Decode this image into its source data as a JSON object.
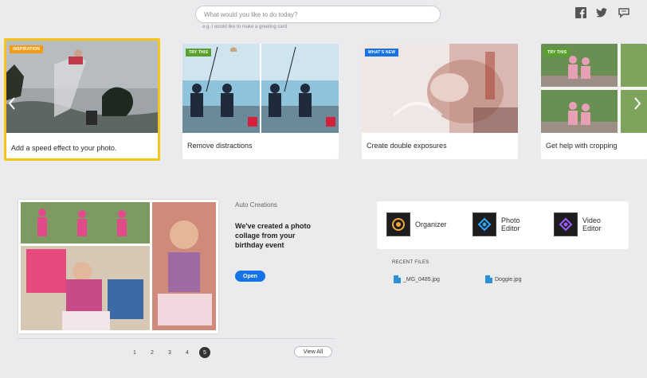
{
  "search": {
    "placeholder": "What would you like to do today?",
    "hint": "e.g. I would like to make a greeting card"
  },
  "social": [
    "facebook-icon",
    "twitter-icon",
    "feedback-icon"
  ],
  "carousel": {
    "cards": [
      {
        "badge": "INSPIRATION",
        "badge_color": "#f39c12",
        "label": "Add a speed effect to your photo."
      },
      {
        "badge": "TRY THIS",
        "badge_color": "#5aa02c",
        "label": "Remove distractions"
      },
      {
        "badge": "WHAT'S NEW",
        "badge_color": "#1473e6",
        "label": "Create double exposures"
      },
      {
        "badge": "TRY THIS",
        "badge_color": "#5aa02c",
        "label": "Get help with cropping"
      }
    ],
    "prev_icon": "chevron-left-icon",
    "next_icon": "chevron-right-icon"
  },
  "auto_creations": {
    "heading": "Auto Creations",
    "title": "We've created a photo collage from your birthday event",
    "open_label": "Open"
  },
  "pager": {
    "pages": [
      "1",
      "2",
      "3",
      "4",
      "5"
    ],
    "active": "5",
    "view_all": "View All"
  },
  "apps": [
    {
      "name": "Organizer",
      "color": "#f1a43a"
    },
    {
      "name": "Photo Editor",
      "color": "#31a8ff"
    },
    {
      "name": "Video Editor",
      "color": "#9f5cff"
    }
  ],
  "recent": {
    "heading": "RECENT FILES",
    "files": [
      "_MG_0485.jpg",
      "Doggie.jpg"
    ]
  },
  "colors": {
    "accent": "#1473e6",
    "highlight": "#f5c518",
    "background": "#ebebee"
  }
}
